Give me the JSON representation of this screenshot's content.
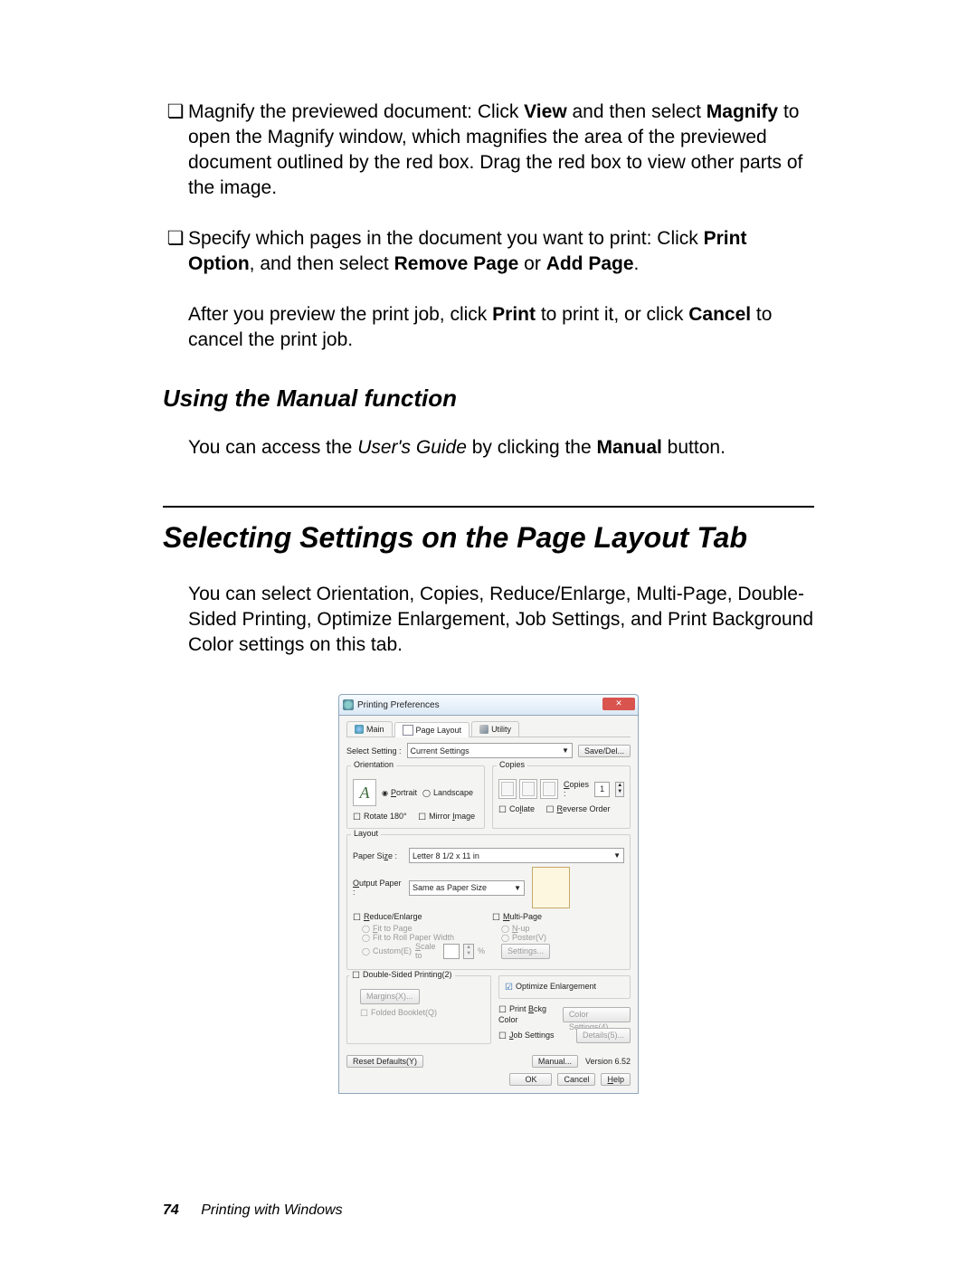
{
  "doc": {
    "bullets": [
      {
        "pre": "Magnify the previewed document: Click ",
        "b1": "View",
        "mid": " and then select ",
        "b2": "Magnify",
        "post": " to open the Magnify window, which magnifies the area of the previewed document outlined by the red box. Drag the red box to view other parts of the image."
      },
      {
        "pre": "Specify which pages in the document you want to print: Click ",
        "b1": "Print Option",
        "mid": ", and then select ",
        "b2": "Remove Page",
        "mid2": " or ",
        "b3": "Add Page",
        "post": "."
      }
    ],
    "para_after": {
      "pre": "After you preview the print job, click ",
      "b1": "Print",
      "mid": " to print it, or click ",
      "b2": "Cancel",
      "post": " to cancel the print job."
    },
    "subhead": "Using the Manual function",
    "sub_para": {
      "pre": "You can access the ",
      "i1": "User's Guide",
      "mid": " by clicking the ",
      "b1": "Manual",
      "post": " button."
    },
    "section_head": "Selecting Settings on the Page Layout Tab",
    "section_para": "You can select Orientation, Copies, Reduce/Enlarge, Multi-Page, Double-Sided Printing, Optimize Enlargement, Job Settings, and Print Background Color settings on this tab.",
    "footer_page": "74",
    "footer_text": "Printing with Windows"
  },
  "dialog": {
    "title": "Printing Preferences",
    "tabs": {
      "main": "Main",
      "page_layout": "Page Layout",
      "utility": "Utility"
    },
    "select_setting_label": "Select Setting :",
    "select_setting_value": "Current Settings",
    "save_del": "Save/Del...",
    "orientation": {
      "label": "Orientation",
      "portrait": "Portrait",
      "landscape": "Landscape",
      "rotate": "Rotate 180°",
      "mirror": "Mirror Image"
    },
    "copies": {
      "label": "Copies",
      "copies_label": "Copies :",
      "value": "1",
      "collate": "Collate",
      "reverse": "Reverse Order"
    },
    "layout": {
      "label": "Layout",
      "paper_size_label": "Paper Size :",
      "paper_size_value": "Letter 8 1/2 x 11 in",
      "output_paper_label": "Output Paper :",
      "output_paper_value": "Same as Paper Size",
      "reduce_enlarge": "Reduce/Enlarge",
      "fit_to_page": "Fit to Page",
      "fit_to_roll": "Fit to Roll Paper Width",
      "custom": "Custom(E)",
      "scale_to": "Scale to",
      "multi_page": "Multi-Page",
      "nup": "N-up",
      "poster": "Poster(V)",
      "settings": "Settings..."
    },
    "dsp": {
      "label": "Double-Sided Printing(2)",
      "margins": "Margins(X)...",
      "folded": "Folded Booklet(Q)"
    },
    "optimize": "Optimize Enlargement",
    "print_bkg": "Print Bckg Color",
    "color_settings": "Color Settings(4)...",
    "job_settings": "Job Settings",
    "details": "Details(5)...",
    "reset": "Reset Defaults(Y)",
    "manual": "Manual...",
    "version": "Version 6.52",
    "ok": "OK",
    "cancel": "Cancel",
    "help": "Help"
  }
}
